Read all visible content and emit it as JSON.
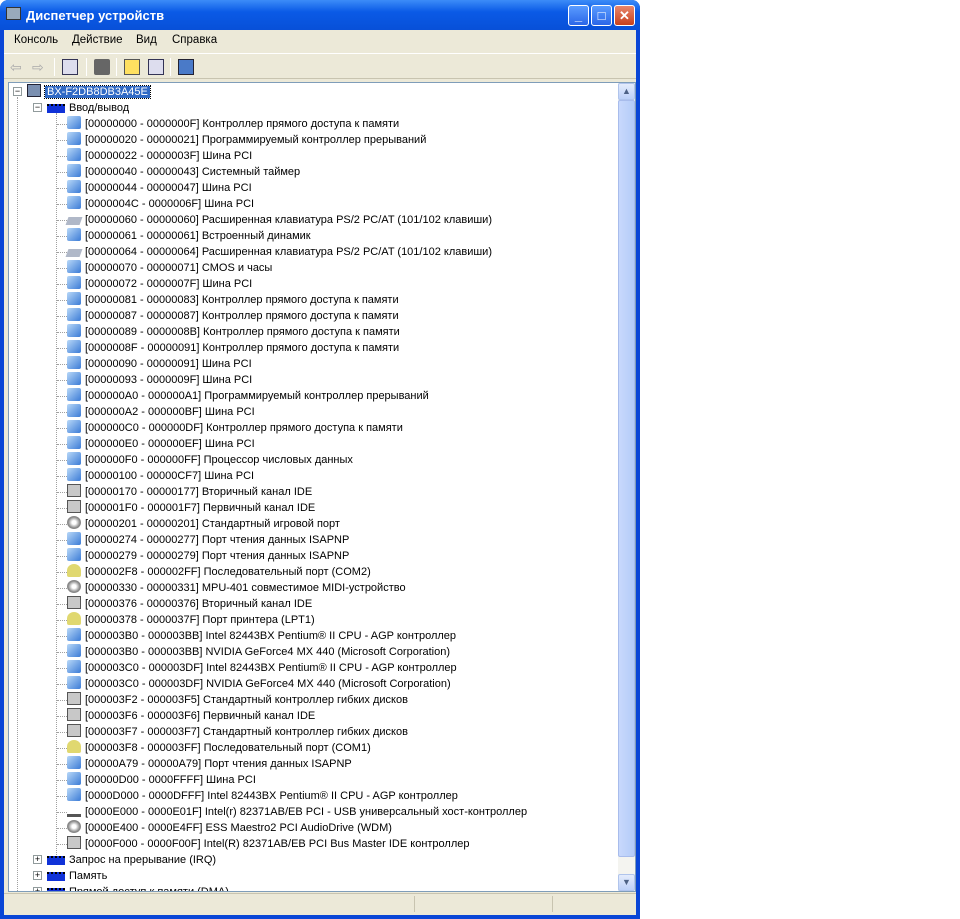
{
  "window": {
    "title": "Диспетчер устройств"
  },
  "menu": [
    "Консоль",
    "Действие",
    "Вид",
    "Справка"
  ],
  "toolbar": [
    "back-icon",
    "forward-icon",
    "show-hide-tree-icon",
    "print-icon",
    "help-icon",
    "properties-pane-icon",
    "update-driver-icon"
  ],
  "tree": {
    "root": "BX-F2DB8DB3A45E",
    "group": "Ввод/вывод",
    "items": [
      {
        "t": "dev",
        "text": "[00000000 - 0000000F]  Контроллер прямого доступа к памяти"
      },
      {
        "t": "dev",
        "text": "[00000020 - 00000021]  Программируемый контроллер прерываний"
      },
      {
        "t": "dev",
        "text": "[00000022 - 0000003F]  Шина PCI"
      },
      {
        "t": "dev",
        "text": "[00000040 - 00000043]  Системный таймер"
      },
      {
        "t": "dev",
        "text": "[00000044 - 00000047]  Шина PCI"
      },
      {
        "t": "dev",
        "text": "[0000004C - 0000006F]  Шина PCI"
      },
      {
        "t": "kbd",
        "text": "[00000060 - 00000060]  Расширенная клавиатура PS/2 PC/AT (101/102 клавиши)"
      },
      {
        "t": "dev",
        "text": "[00000061 - 00000061]  Встроенный динамик"
      },
      {
        "t": "kbd",
        "text": "[00000064 - 00000064]  Расширенная клавиатура PS/2 PC/AT (101/102 клавиши)"
      },
      {
        "t": "dev",
        "text": "[00000070 - 00000071]  CMOS и часы"
      },
      {
        "t": "dev",
        "text": "[00000072 - 0000007F]  Шина PCI"
      },
      {
        "t": "dev",
        "text": "[00000081 - 00000083]  Контроллер прямого доступа к памяти"
      },
      {
        "t": "dev",
        "text": "[00000087 - 00000087]  Контроллер прямого доступа к памяти"
      },
      {
        "t": "dev",
        "text": "[00000089 - 0000008B]  Контроллер прямого доступа к памяти"
      },
      {
        "t": "dev",
        "text": "[0000008F - 00000091]  Контроллер прямого доступа к памяти"
      },
      {
        "t": "dev",
        "text": "[00000090 - 00000091]  Шина PCI"
      },
      {
        "t": "dev",
        "text": "[00000093 - 0000009F]  Шина PCI"
      },
      {
        "t": "dev",
        "text": "[000000A0 - 000000A1]  Программируемый контроллер прерываний"
      },
      {
        "t": "dev",
        "text": "[000000A2 - 000000BF]  Шина PCI"
      },
      {
        "t": "dev",
        "text": "[000000C0 - 000000DF]  Контроллер прямого доступа к памяти"
      },
      {
        "t": "dev",
        "text": "[000000E0 - 000000EF]  Шина PCI"
      },
      {
        "t": "dev",
        "text": "[000000F0 - 000000FF]  Процессор числовых данных"
      },
      {
        "t": "dev",
        "text": "[00000100 - 00000CF7]  Шина PCI"
      },
      {
        "t": "ide",
        "text": "[00000170 - 00000177]  Вторичный канал IDE"
      },
      {
        "t": "ide",
        "text": "[000001F0 - 000001F7]  Первичный канал IDE"
      },
      {
        "t": "snd",
        "text": "[00000201 - 00000201]  Стандартный игровой порт"
      },
      {
        "t": "dev",
        "text": "[00000274 - 00000277]  Порт чтения данных ISAPNP"
      },
      {
        "t": "dev",
        "text": "[00000279 - 00000279]  Порт чтения данных ISAPNP"
      },
      {
        "t": "port",
        "text": "[000002F8 - 000002FF]  Последовательный порт (COM2)"
      },
      {
        "t": "snd",
        "text": "[00000330 - 00000331]  MPU-401 совместимое MIDI-устройство"
      },
      {
        "t": "ide",
        "text": "[00000376 - 00000376]  Вторичный канал IDE"
      },
      {
        "t": "port",
        "text": "[00000378 - 0000037F]  Порт принтера (LPT1)"
      },
      {
        "t": "dev",
        "text": "[000003B0 - 000003BB]  Intel 82443BX Pentium® II CPU - AGP контроллер"
      },
      {
        "t": "dev",
        "text": "[000003B0 - 000003BB]  NVIDIA GeForce4 MX 440 (Microsoft Corporation)"
      },
      {
        "t": "dev",
        "text": "[000003C0 - 000003DF]  Intel 82443BX Pentium® II CPU - AGP контроллер"
      },
      {
        "t": "dev",
        "text": "[000003C0 - 000003DF]  NVIDIA GeForce4 MX 440 (Microsoft Corporation)"
      },
      {
        "t": "ide",
        "text": "[000003F2 - 000003F5]  Стандартный контроллер гибких дисков"
      },
      {
        "t": "ide",
        "text": "[000003F6 - 000003F6]  Первичный канал IDE"
      },
      {
        "t": "ide",
        "text": "[000003F7 - 000003F7]  Стандартный контроллер гибких дисков"
      },
      {
        "t": "port",
        "text": "[000003F8 - 000003FF]  Последовательный порт (COM1)"
      },
      {
        "t": "dev",
        "text": "[00000A79 - 00000A79]  Порт чтения данных ISAPNP"
      },
      {
        "t": "dev",
        "text": "[00000D00 - 0000FFFF]  Шина PCI"
      },
      {
        "t": "dev",
        "text": "[0000D000 - 0000DFFF]  Intel 82443BX Pentium® II CPU - AGP контроллер"
      },
      {
        "t": "usb",
        "text": "[0000E000 - 0000E01F]  Intel(r) 82371AB/EB PCI - USB универсальный хост-контроллер"
      },
      {
        "t": "snd",
        "text": "[0000E400 - 0000E4FF]  ESS Maestro2 PCI AudioDrive (WDM)"
      },
      {
        "t": "ide",
        "text": "[0000F000 - 0000F00F]  Intel(R) 82371AB/EB PCI Bus Master IDE контроллер"
      }
    ],
    "collapsed": [
      "Запрос на прерывание (IRQ)",
      "Память",
      "Прямой доступ к памяти (DMA)"
    ]
  }
}
